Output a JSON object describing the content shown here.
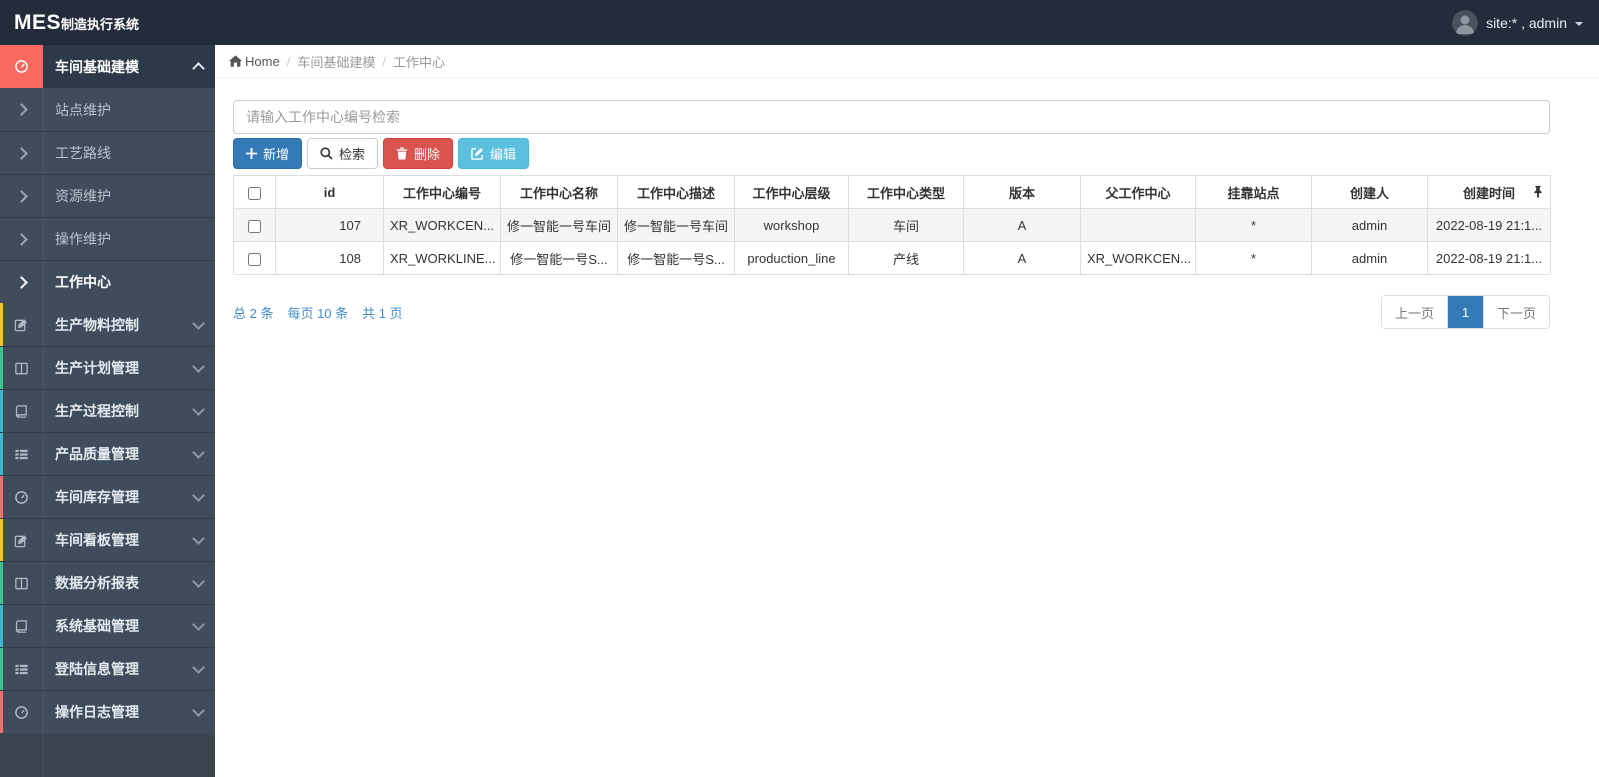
{
  "navbar": {
    "logo_bold": "MES",
    "logo_rest": "制造执行系统",
    "user_label": "site:* , admin"
  },
  "sidebar": {
    "active_group": {
      "label": "车间基础建模",
      "icon": "dashboard-icon"
    },
    "sub_items": [
      {
        "label": "站点维护",
        "active": false
      },
      {
        "label": "工艺路线",
        "active": false
      },
      {
        "label": "资源维护",
        "active": false
      },
      {
        "label": "操作维护",
        "active": false
      },
      {
        "label": "工作中心",
        "active": true
      }
    ],
    "groups": [
      {
        "label": "生产物料控制",
        "icon": "edit-icon",
        "strip_color": "#f0c330"
      },
      {
        "label": "生产计划管理",
        "icon": "columns-icon",
        "strip_color": "#43bf8f"
      },
      {
        "label": "生产过程控制",
        "icon": "book-icon",
        "strip_color": "#3fb6c9"
      },
      {
        "label": "产品质量管理",
        "icon": "list-icon",
        "strip_color": "#3fb6c9"
      },
      {
        "label": "车间库存管理",
        "icon": "dashboard-icon",
        "strip_color": "#f0716d"
      },
      {
        "label": "车间看板管理",
        "icon": "edit-icon",
        "strip_color": "#f0c330"
      },
      {
        "label": "数据分析报表",
        "icon": "columns-icon",
        "strip_color": "#43bf8f"
      },
      {
        "label": "系统基础管理",
        "icon": "book-icon",
        "strip_color": "#3fb6c9"
      },
      {
        "label": "登陆信息管理",
        "icon": "list-icon",
        "strip_color": "#43bf8f"
      },
      {
        "label": "操作日志管理",
        "icon": "dashboard-icon",
        "strip_color": "#f0716d"
      }
    ]
  },
  "breadcrumb": {
    "home": "Home",
    "items": [
      "车间基础建模",
      "工作中心"
    ]
  },
  "toolbar": {
    "search_placeholder": "请输入工作中心编号检索",
    "add_label": "新增",
    "search_label": "检索",
    "delete_label": "删除",
    "edit_label": "编辑"
  },
  "table": {
    "columns": [
      "id",
      "工作中心编号",
      "工作中心名称",
      "工作中心描述",
      "工作中心层级",
      "工作中心类型",
      "版本",
      "父工作中心",
      "挂靠站点",
      "创建人",
      "创建时间"
    ],
    "rows": [
      [
        "107",
        "XR_WORKCEN...",
        "修一智能一号车间",
        "修一智能一号车间",
        "workshop",
        "车间",
        "A",
        "",
        "*",
        "admin",
        "2022-08-19 21:1..."
      ],
      [
        "108",
        "XR_WORKLINE...",
        "修一智能一号S...",
        "修一智能一号S...",
        "production_line",
        "产线",
        "A",
        "XR_WORKCEN...",
        "*",
        "admin",
        "2022-08-19 21:1..."
      ]
    ]
  },
  "pagination": {
    "total": "总 2 条",
    "per_page": "每页 10 条",
    "pages": "共 1 页",
    "prev": "上一页",
    "current": "1",
    "next": "下一页"
  },
  "colors": {
    "navbar_bg": "#232c3b",
    "sidebar_bg": "#3e4c5b",
    "active_icon_bg": "#f9695d",
    "primary": "#337ab7",
    "danger": "#d9534f",
    "info": "#5bc0de",
    "link": "#428bca"
  }
}
